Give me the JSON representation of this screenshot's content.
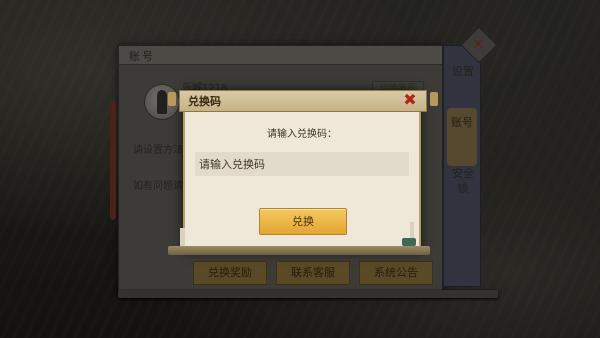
{
  "panel": {
    "title": "账号",
    "username": "乐城1218",
    "switch_label": "切换账号",
    "line1": "请设置方法",
    "line2": "如有问题请",
    "buttons": [
      "兑换奖励",
      "联系客服",
      "系统公告"
    ]
  },
  "sidebar": {
    "tabs": [
      "设置",
      "账号",
      "安全锁"
    ],
    "active_index": 1
  },
  "dialog": {
    "title": "兑换码",
    "prompt": "请输入兑换码：",
    "input_placeholder": "请输入兑换码",
    "input_value": "",
    "confirm_label": "兑换",
    "close_glyph": "✖"
  },
  "colors": {
    "accent_button": "#e8ae3a",
    "close_red": "#b0261a",
    "dialog_bg": "#efe8d9"
  }
}
